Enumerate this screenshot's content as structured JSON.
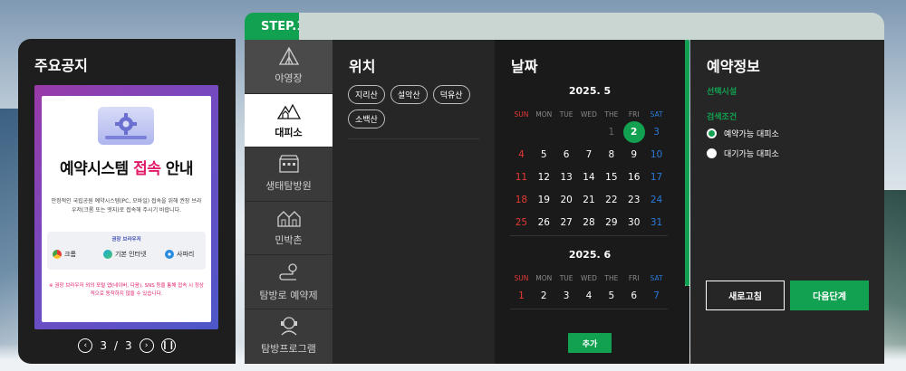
{
  "colors": {
    "accent": "#12a150",
    "sunday": "#e53935",
    "saturday": "#2a7ad9"
  },
  "notice": {
    "title": "주요공지",
    "banner": {
      "headline_pre": "예약시스템 ",
      "headline_accent": "접속",
      "headline_post": " 안내",
      "desc": "안정적인 국립공원 예약시스템(PC, 모바일) 접속을 위해 권장 브라우저(크롬 또는 엣지)로 접속해 주시기 바랍니다.",
      "browsers_label": "권장 브라우저",
      "browsers": [
        "크롬",
        "기본 인터넷",
        "사파리"
      ],
      "warning": "※ 권장 브라우저 외의 포털 앱(네이버, 다음), SNS 등을 통해 접속 시 정상적으로 동작하지 않을 수 있습니다."
    },
    "pager": {
      "current": "3",
      "separator": "/",
      "total": "3"
    }
  },
  "step": {
    "label": "STEP.1"
  },
  "nav": {
    "items": [
      {
        "label": "야영장",
        "icon": "tent-icon"
      },
      {
        "label": "대피소",
        "icon": "mountain-shelter-icon"
      },
      {
        "label": "생태탐방원",
        "icon": "building-icon"
      },
      {
        "label": "민박촌",
        "icon": "house-icon"
      },
      {
        "label": "탐방로 예약제",
        "icon": "trail-route-icon"
      },
      {
        "label": "탐방프로그램",
        "icon": "guide-icon"
      }
    ],
    "active": "대피소"
  },
  "location": {
    "title": "위치",
    "chips": [
      "지리산",
      "설악산",
      "덕유산",
      "소백산"
    ]
  },
  "date": {
    "title": "날짜",
    "weekdays": [
      "SUN",
      "MON",
      "TUE",
      "WED",
      "THE",
      "FRI",
      "SAT"
    ],
    "months": [
      {
        "title": "2025. 5",
        "selected": "2",
        "weeks": [
          [
            "",
            "",
            "",
            "",
            "1",
            "2",
            "3"
          ],
          [
            "4",
            "5",
            "6",
            "7",
            "8",
            "9",
            "10"
          ],
          [
            "11",
            "12",
            "13",
            "14",
            "15",
            "16",
            "17"
          ],
          [
            "18",
            "19",
            "20",
            "21",
            "22",
            "23",
            "24"
          ],
          [
            "25",
            "26",
            "27",
            "28",
            "29",
            "30",
            "31"
          ]
        ]
      },
      {
        "title": "2025. 6",
        "weeks": [
          [
            "1",
            "2",
            "3",
            "4",
            "5",
            "6",
            "7"
          ]
        ]
      }
    ],
    "add_label": "추가"
  },
  "info": {
    "title": "예약정보",
    "facility_label": "선택시설",
    "condition_label": "검색조건",
    "options": [
      {
        "label": "예약가능 대피소",
        "checked": true
      },
      {
        "label": "대기가능 대피소",
        "checked": false
      }
    ],
    "reset_label": "새로고침",
    "next_label": "다음단계"
  }
}
